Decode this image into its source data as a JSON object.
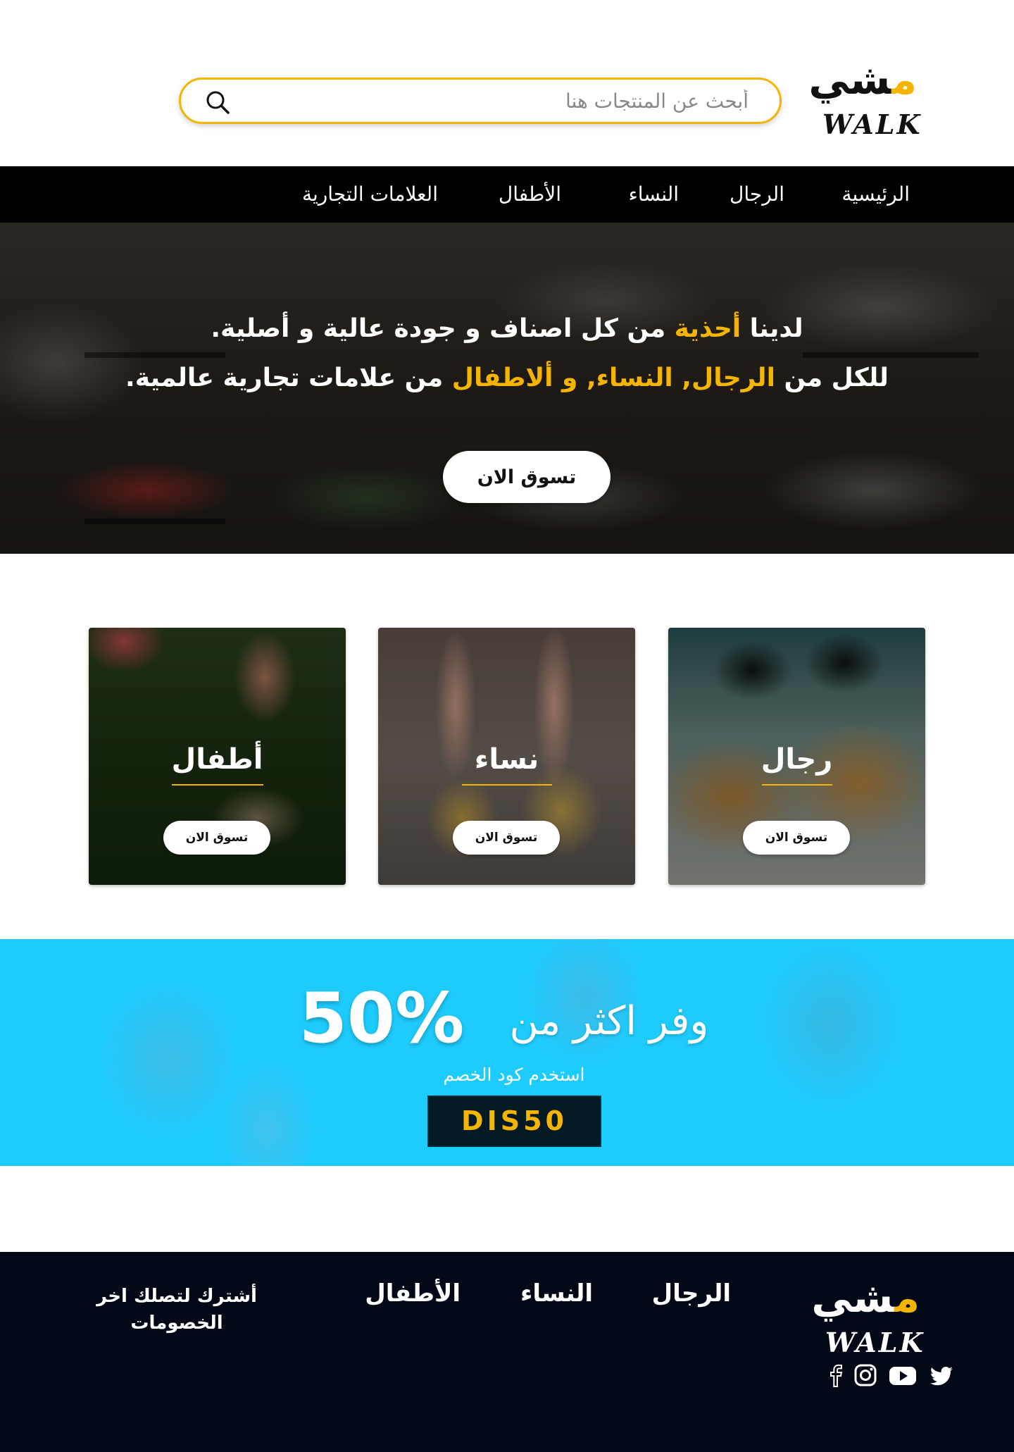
{
  "brand": {
    "arabic_logo": "مشي",
    "english_logo": "WALK",
    "accent_color": "#f5b400"
  },
  "search": {
    "placeholder": "أبحث عن المنتجات هنا",
    "icon": "search-icon"
  },
  "nav": {
    "items": [
      {
        "label": "الرئيسية"
      },
      {
        "label": "الرجال"
      },
      {
        "label": "النساء"
      },
      {
        "label": "الأطفال"
      },
      {
        "label": "العلامات التجارية"
      }
    ]
  },
  "hero": {
    "line1": {
      "part1": "لدينا ",
      "highlight": "أحذية",
      "part2": " من كل اصناف و جودة عالية و أصلية."
    },
    "line2": {
      "part1": "للكل من ",
      "highlight": "الرجال, النساء, و ألاطفال",
      "part2": " من علامات تجارية عالمية."
    },
    "cta": "تسوق الان"
  },
  "categories": [
    {
      "title": "رجال",
      "button": "تسوق الان"
    },
    {
      "title": "نساء",
      "button": "تسوق الان"
    },
    {
      "title": "أطفال",
      "button": "تسوق الان"
    }
  ],
  "promo": {
    "save_text": "وفر اكثر من",
    "percent": "50%",
    "use_code_text": "استخدم كود الخصم",
    "code": "DIS50",
    "background_color": "#1ecbfd"
  },
  "footer": {
    "links": [
      {
        "label": "الرجال"
      },
      {
        "label": "النساء"
      },
      {
        "label": "الأطفال"
      }
    ],
    "subscribe": "أشترك لتصلك اخر الخصومات",
    "social": [
      "facebook-icon",
      "instagram-icon",
      "youtube-icon",
      "twitter-icon"
    ],
    "background_color": "#020816"
  }
}
